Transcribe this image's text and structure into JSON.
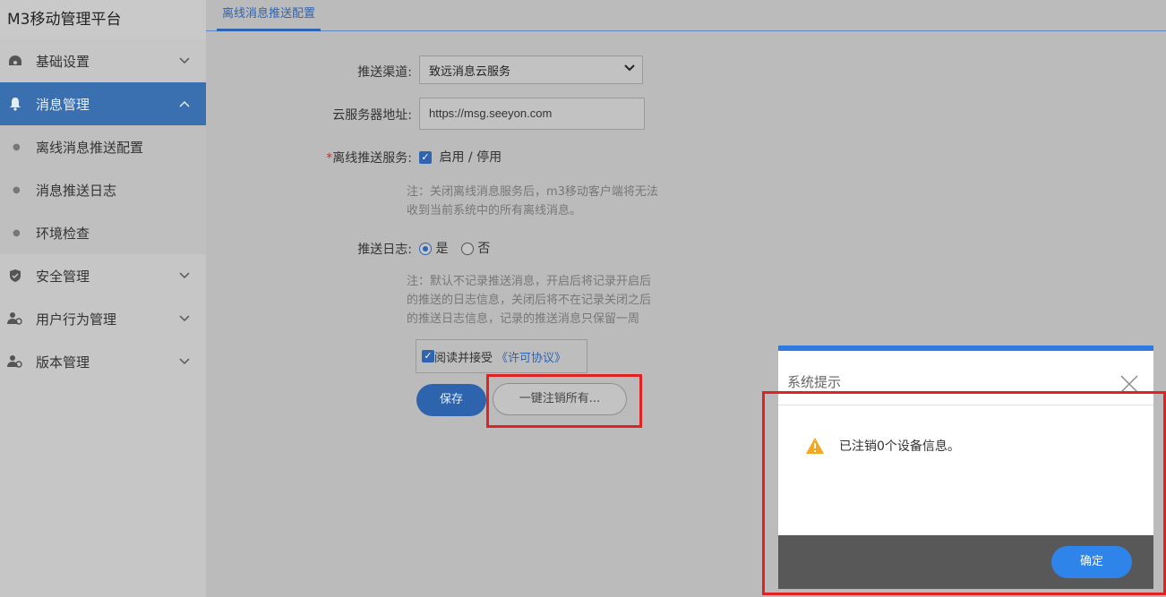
{
  "sidebar": {
    "brand": "M3移动管理平台",
    "items": [
      {
        "label": "基础设置",
        "icon": "dashboard-icon",
        "expanded": false
      },
      {
        "label": "消息管理",
        "icon": "bell-icon",
        "expanded": true
      },
      {
        "label": "安全管理",
        "icon": "shield-icon",
        "expanded": false
      },
      {
        "label": "用户行为管理",
        "icon": "users-icon",
        "expanded": false
      },
      {
        "label": "版本管理",
        "icon": "users-icon",
        "expanded": false
      }
    ],
    "sub_items": [
      "离线消息推送配置",
      "消息推送日志",
      "环境检查"
    ]
  },
  "main": {
    "tab": "离线消息推送配置",
    "form": {
      "channel_label": "推送渠道:",
      "channel_value": "致远消息云服务",
      "server_label": "云服务器地址:",
      "server_value": "https://msg.seeyon.com",
      "offline_required_mark": "*",
      "offline_label": "离线推送服务:",
      "offline_value": "启用 / 停用",
      "offline_checked": true,
      "note1_line1": "注：关闭离线消息服务后，m3移动客户端将无法",
      "note1_line2": "收到当前系统中的所有离线消息。",
      "log_label": "推送日志:",
      "log_yes": "是",
      "log_no": "否",
      "log_selected": "是",
      "note2_line1": "注：默认不记录推送消息，开启后将记录开启后",
      "note2_line2": "的推送的日志信息，关闭后将不在记录关闭之后",
      "note2_line3": "的推送日志信息，记录的推送消息只保留一周",
      "agree_text": "阅读并接受",
      "agree_link": "《许可协议》",
      "agree_checked": true,
      "save_button": "保存",
      "revoke_button": "一键注销所有..."
    }
  },
  "dialog": {
    "title": "系统提示",
    "message": "已注销0个设备信息。",
    "ok_button": "确定"
  },
  "colors": {
    "accent": "#2f64b0",
    "highlight": "#e02222",
    "warning": "#f5a623"
  }
}
